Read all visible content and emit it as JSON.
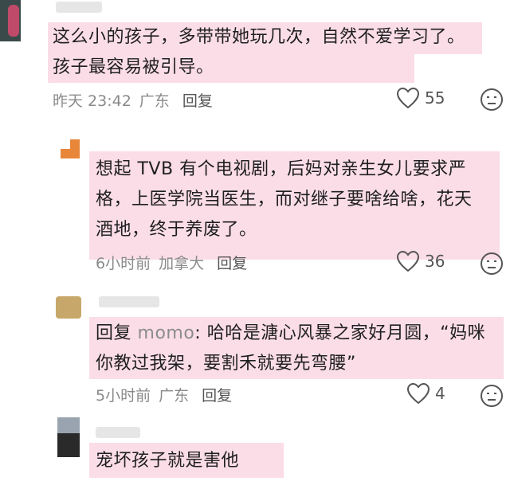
{
  "comments": [
    {
      "text": "这么小的孩子，多带带她玩几次，自然不爱学习了。\n孩子最容易被引导。",
      "time": "昨天 23:42",
      "location": "广东",
      "reply_label": "回复",
      "likes": "55"
    },
    {
      "text": "想起 TVB 有个电视剧，后妈对亲生女儿要求严\n格，上医学院当医生，而对继子要啥给啥，花天\n酒地，终于养废了。",
      "time": "6小时前",
      "location": "加拿大",
      "reply_label": "回复",
      "likes": "36"
    },
    {
      "reply_prefix": "回复",
      "mention": "momo",
      "text": ": 哈哈是溏心风暴之家好月圆，“妈咪\n你教过我架，要割禾就要先弯腰”",
      "time": "5小时前",
      "location": "广东",
      "reply_label": "回复",
      "likes": "4"
    },
    {
      "text": "宠坏孩子就是害他"
    }
  ],
  "colors": {
    "highlight": "#fbdde8",
    "meta_text": "#8a8a8a",
    "mention": "#8c8c8c"
  },
  "icons": [
    "heart-icon",
    "emoji-face-icon"
  ]
}
